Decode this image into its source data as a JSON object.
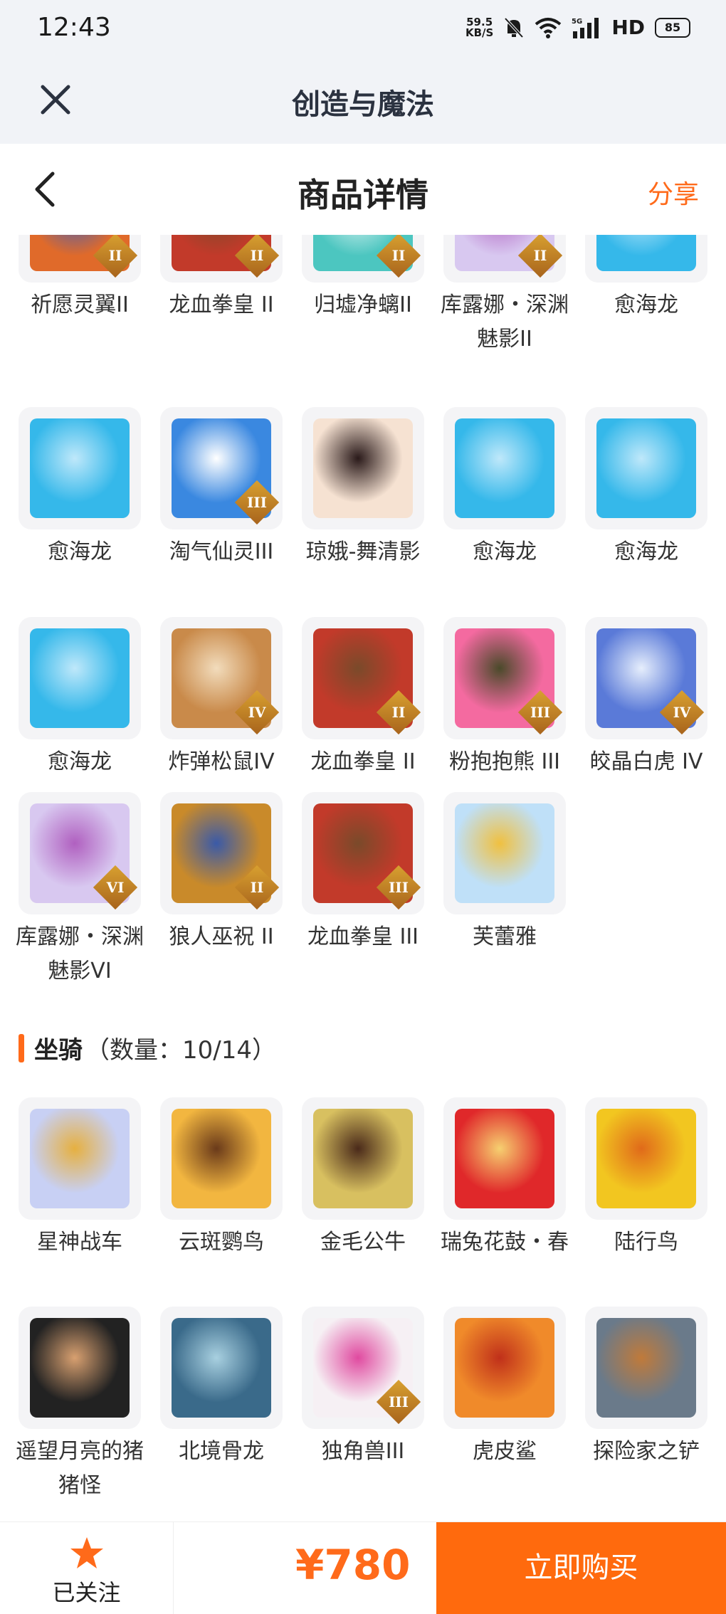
{
  "status_bar": {
    "time": "12:43",
    "net_speed_top": "59.5",
    "net_speed_bottom": "KB/S",
    "network": "HD",
    "battery": "85"
  },
  "app_header": {
    "title": "创造与魔法"
  },
  "page_header": {
    "title": "商品详情",
    "share": "分享"
  },
  "pets_continued": [
    {
      "label": "祈愿灵翼II",
      "icon": "griffin-icon",
      "badge": "II"
    },
    {
      "label": "龙血拳皇 II",
      "icon": "dragon-boxer-icon",
      "badge": "II"
    },
    {
      "label": "归墟净螭II",
      "icon": "sea-serpent-icon",
      "badge": "II"
    },
    {
      "label": "库露娜・深渊魅影II",
      "icon": "kuluna-icon",
      "badge": "II"
    },
    {
      "label": "愈海龙",
      "icon": "sea-dragon-icon",
      "badge": ""
    },
    {
      "label": "愈海龙",
      "icon": "sea-dragon-icon",
      "badge": ""
    },
    {
      "label": "淘气仙灵III",
      "icon": "blue-pup-icon",
      "badge": "III"
    },
    {
      "label": "琼娥-舞清影",
      "icon": "dancer-icon",
      "badge": ""
    },
    {
      "label": "愈海龙",
      "icon": "sea-dragon-icon",
      "badge": ""
    },
    {
      "label": "愈海龙",
      "icon": "sea-dragon-icon",
      "badge": ""
    },
    {
      "label": "愈海龙",
      "icon": "sea-dragon-icon",
      "badge": ""
    },
    {
      "label": "炸弹松鼠IV",
      "icon": "squirrel-icon",
      "badge": "IV"
    },
    {
      "label": "龙血拳皇 II",
      "icon": "dragon-boxer-icon",
      "badge": "II"
    },
    {
      "label": "粉抱抱熊 III",
      "icon": "pink-bear-icon",
      "badge": "III"
    },
    {
      "label": "皎晶白虎 IV",
      "icon": "white-tiger-icon",
      "badge": "IV"
    },
    {
      "label": "库露娜・深渊魅影VI",
      "icon": "kuluna-icon",
      "badge": "VI"
    },
    {
      "label": "狼人巫祝 II",
      "icon": "werewolf-icon",
      "badge": "II"
    },
    {
      "label": "龙血拳皇 III",
      "icon": "dragon-boxer-icon",
      "badge": "III"
    },
    {
      "label": "芙蕾雅",
      "icon": "freya-icon",
      "badge": ""
    }
  ],
  "mounts_section": {
    "title": "坐骑",
    "count": "（数量：10/14）"
  },
  "mounts": [
    {
      "label": "星神战车",
      "icon": "star-chariot-icon",
      "badge": ""
    },
    {
      "label": "云斑鹦鸟",
      "icon": "parrot-icon",
      "badge": ""
    },
    {
      "label": "金毛公牛",
      "icon": "golden-bull-icon",
      "badge": ""
    },
    {
      "label": "瑞兔花鼓・春",
      "icon": "rabbit-drum-icon",
      "badge": ""
    },
    {
      "label": "陆行鸟",
      "icon": "land-bird-icon",
      "badge": ""
    },
    {
      "label": "遥望月亮的猪猪怪",
      "icon": "pig-icon",
      "badge": ""
    },
    {
      "label": "北境骨龙",
      "icon": "bone-dragon-icon",
      "badge": ""
    },
    {
      "label": "独角兽III",
      "icon": "unicorn-icon",
      "badge": "III"
    },
    {
      "label": "虎皮鲨",
      "icon": "tiger-shark-icon",
      "badge": ""
    },
    {
      "label": "探险家之铲",
      "icon": "shovel-icon",
      "badge": ""
    }
  ],
  "bottom_bar": {
    "follow_label": "已关注",
    "price": "¥780",
    "buy_label": "立即购买"
  },
  "colors": {
    "accent": "#ff6a1a",
    "header_bg": "#f1f3f7",
    "buy_bg": "#ff6a0d"
  }
}
